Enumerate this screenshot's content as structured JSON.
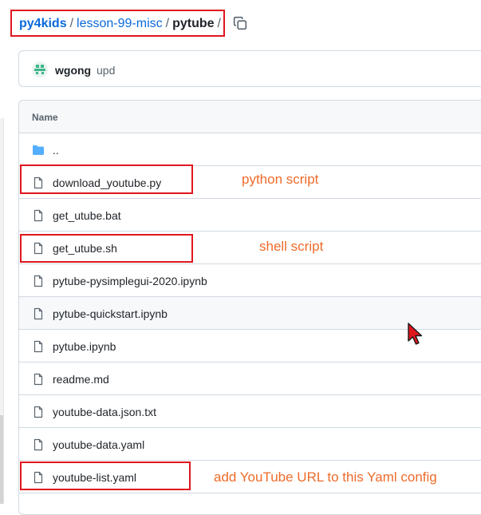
{
  "breadcrumb": {
    "repo": "py4kids",
    "folder": "lesson-99-misc",
    "current": "pytube",
    "separator": "/"
  },
  "commit": {
    "user": "wgong",
    "message": "upd"
  },
  "table": {
    "header_name": "Name",
    "parent_dir": "..",
    "files": [
      "download_youtube.py",
      "get_utube.bat",
      "get_utube.sh",
      "pytube-pysimplegui-2020.ipynb",
      "pytube-quickstart.ipynb",
      "pytube.ipynb",
      "readme.md",
      "youtube-data.json.txt",
      "youtube-data.yaml",
      "youtube-list.yaml"
    ]
  },
  "annotations": {
    "python": "python script",
    "shell": "shell script",
    "yaml": "add YouTube URL to this Yaml config"
  },
  "colors": {
    "link": "#0969da",
    "highlight_box": "#e0161e",
    "annotation_text": "#ee6b2a",
    "folder": "#54aeff",
    "cursor": "#e0161e"
  },
  "icons": {
    "copy": "copy-icon",
    "folder": "folder-icon",
    "file": "file-icon",
    "avatar": "identicon-avatar",
    "cursor": "mouse-cursor-icon"
  }
}
